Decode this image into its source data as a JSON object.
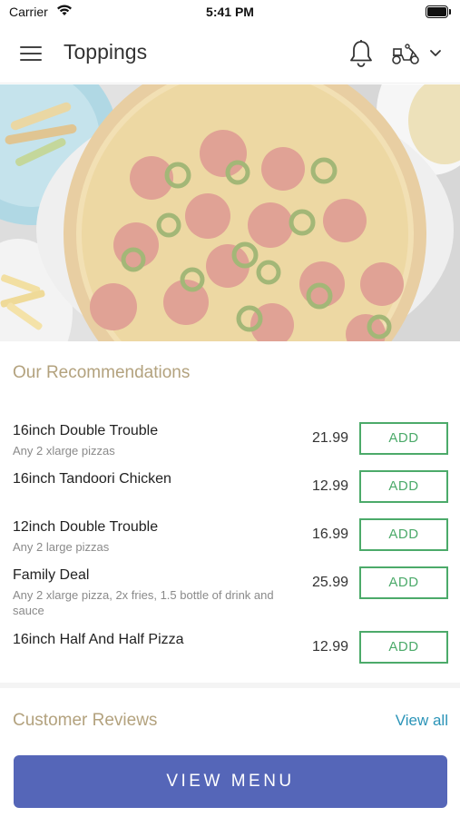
{
  "status_bar": {
    "carrier": "Carrier",
    "time": "5:41 PM"
  },
  "header": {
    "title": "Toppings",
    "icons": [
      "menu-icon",
      "bell-icon",
      "scooter-icon",
      "chevron-down-icon"
    ]
  },
  "recommendations": {
    "title": "Our Recommendations",
    "items": [
      {
        "name": "16inch Double Trouble",
        "description": "Any 2 xlarge pizzas",
        "price": "21.99",
        "button": "ADD"
      },
      {
        "name": "16inch Tandoori Chicken",
        "description": "",
        "price": "12.99",
        "button": "ADD"
      },
      {
        "name": "12inch Double Trouble",
        "description": "Any 2 large pizzas",
        "price": "16.99",
        "button": "ADD"
      },
      {
        "name": "Family Deal",
        "description": "Any 2 xlarge pizza, 2x fries, 1.5 bottle of drink and sauce",
        "price": "25.99",
        "button": "ADD"
      },
      {
        "name": "16inch Half And Half Pizza",
        "description": "",
        "price": "12.99",
        "button": "ADD"
      }
    ]
  },
  "reviews": {
    "title": "Customer Reviews",
    "view_all": "View all"
  },
  "footer": {
    "view_menu": "VIEW MENU"
  },
  "colors": {
    "section_title": "#b3a27e",
    "add_button": "#4caa6a",
    "link": "#2b94b8",
    "primary_button": "#5566b8"
  }
}
